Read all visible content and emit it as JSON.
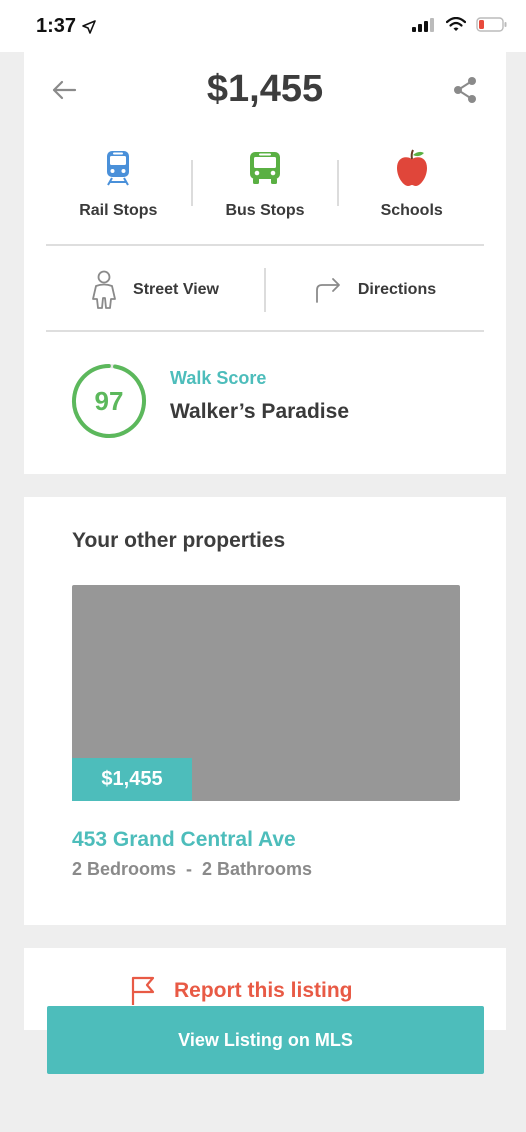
{
  "status_bar": {
    "time": "1:37",
    "icons": [
      "location-arrow-icon",
      "signal-icon",
      "wifi-icon",
      "battery-icon"
    ],
    "battery_color": "#e84a3c"
  },
  "header": {
    "price": "$1,455",
    "back_icon": "arrow-left-icon",
    "share_icon": "share-icon"
  },
  "amenities": [
    {
      "label": "Rail Stops",
      "icon": "train-icon",
      "color": "#4a90d9"
    },
    {
      "label": "Bus Stops",
      "icon": "bus-icon",
      "color": "#5ab043"
    },
    {
      "label": "Schools",
      "icon": "apple-icon",
      "color": "#e0463a"
    }
  ],
  "actions": [
    {
      "label": "Street View",
      "icon": "person-icon"
    },
    {
      "label": "Directions",
      "icon": "turn-right-arrow-icon"
    }
  ],
  "walk_score": {
    "score": "97",
    "score_fraction": 0.97,
    "label": "Walk Score",
    "description": "Walker’s Paradise",
    "ring_color": "#5cb85c"
  },
  "other_properties": {
    "heading": "Your other properties",
    "items": [
      {
        "price": "$1,455",
        "address": "453 Grand Central Ave",
        "details": "2 Bedrooms  -  2 Bathrooms"
      }
    ]
  },
  "report": {
    "label": "Report this listing",
    "icon": "flag-icon",
    "color": "#e85a45"
  },
  "cta": {
    "label": "View Listing on MLS"
  },
  "colors": {
    "accent": "#4dbdbb",
    "background": "#eeeeee",
    "card": "#ffffff"
  }
}
